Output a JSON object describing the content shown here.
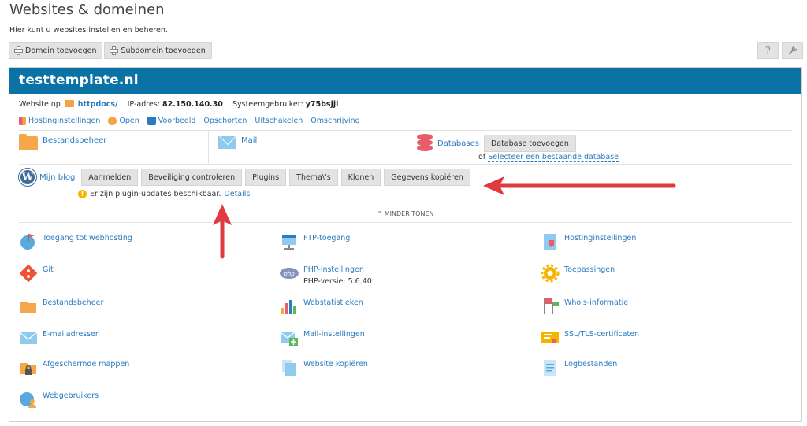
{
  "page": {
    "title": "Websites & domeinen",
    "subtitle": "Hier kunt u websites instellen en beheren."
  },
  "toolbar": {
    "add_domain": "Domein toevoegen",
    "add_subdomain": "Subdomein toevoegen",
    "help_icon": "question-icon",
    "tools_icon": "wrench-icon"
  },
  "site": {
    "name": "testtemplate.nl",
    "website_on_label": "Website op",
    "docroot": "httpdocs/",
    "ip_label": "IP-adres:",
    "ip": "82.150.140.30",
    "user_label": "Systeemgebruiker:",
    "user": "y75bsjjl",
    "actions": [
      "Hostinginstellingen",
      "Open",
      "Voorbeeld",
      "Opschorten",
      "Uitschakelen",
      "Omschrijving"
    ]
  },
  "quick": {
    "files": "Bestandsbeheer",
    "mail": "Mail",
    "databases": "Databases",
    "add_db": "Database toevoegen",
    "or": "of",
    "select_db": "Selecteer een bestaande database"
  },
  "wp": {
    "name": "Mijn blog",
    "buttons": [
      "Aanmelden",
      "Beveiliging controleren",
      "Plugins",
      "Thema\\'s",
      "Klonen",
      "Gegevens kopiëren"
    ],
    "notice": "Er zijn plugin-updates beschikbaar.",
    "details": "Details",
    "less": "MINDER TONEN"
  },
  "tools": {
    "col1": [
      "Toegang tot webhosting",
      "Git",
      "Bestandsbeheer",
      "E-mailadressen",
      "Afgeschermde mappen",
      "Webgebruikers"
    ],
    "col2": [
      "FTP-toegang",
      "PHP-instellingen",
      "Webstatistieken",
      "Mail-instellingen",
      "Website kopiëren"
    ],
    "php_version": "PHP-versie: 5.6.40",
    "col3": [
      "Hostinginstellingen",
      "Toepassingen",
      "Whois-informatie",
      "SSL/TLS-certificaten",
      "Logbestanden"
    ]
  },
  "colors": {
    "header_blue": "#0b72a6",
    "link": "#2a7bc0",
    "arrow": "#e0393e",
    "folder": "#f5a74a"
  }
}
